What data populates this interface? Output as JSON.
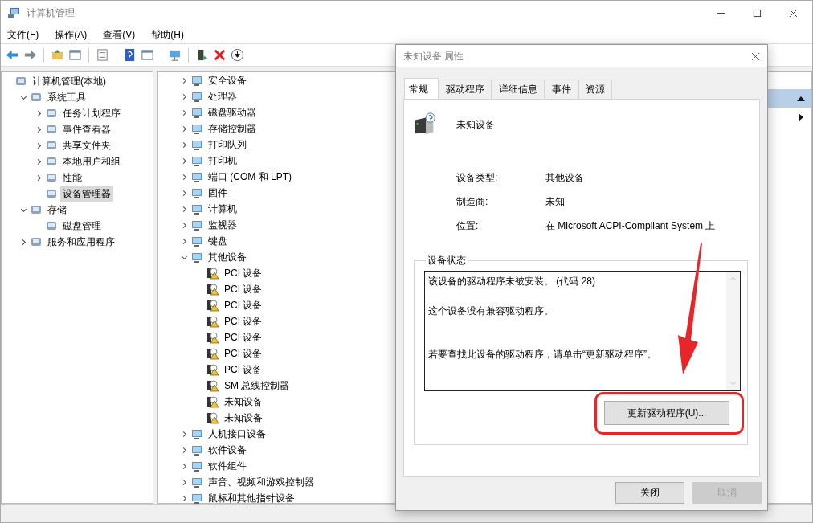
{
  "window": {
    "title": "计算机管理"
  },
  "menu": [
    "文件(F)",
    "操作(A)",
    "查看(V)",
    "帮助(H)"
  ],
  "left_tree": [
    {
      "label": "计算机管理(本地)",
      "selected": false,
      "children": [
        {
          "label": "系统工具",
          "expanded": true,
          "selected": false,
          "children": [
            {
              "label": "任务计划程序",
              "expanded": false,
              "selected": false
            },
            {
              "label": "事件查看器",
              "expanded": false,
              "selected": false
            },
            {
              "label": "共享文件夹",
              "expanded": false,
              "selected": false
            },
            {
              "label": "本地用户和组",
              "expanded": false,
              "selected": false
            },
            {
              "label": "性能",
              "expanded": false,
              "selected": false
            },
            {
              "label": "设备管理器",
              "selected": true
            }
          ]
        },
        {
          "label": "存储",
          "expanded": true,
          "selected": false,
          "children": [
            {
              "label": "磁盘管理",
              "selected": false
            }
          ]
        },
        {
          "label": "服务和应用程序",
          "expanded": false,
          "selected": false
        }
      ]
    }
  ],
  "device_tree": [
    {
      "label": "安全设备",
      "expanded": false
    },
    {
      "label": "处理器",
      "expanded": false
    },
    {
      "label": "磁盘驱动器",
      "expanded": false
    },
    {
      "label": "存储控制器",
      "expanded": false
    },
    {
      "label": "打印队列",
      "expanded": false
    },
    {
      "label": "打印机",
      "expanded": false
    },
    {
      "label": "端口 (COM 和 LPT)",
      "expanded": false
    },
    {
      "label": "固件",
      "expanded": false
    },
    {
      "label": "计算机",
      "expanded": false
    },
    {
      "label": "监视器",
      "expanded": false
    },
    {
      "label": "键盘",
      "expanded": false
    },
    {
      "label": "其他设备",
      "expanded": true,
      "children": [
        {
          "label": "PCI 设备",
          "warning": true
        },
        {
          "label": "PCI 设备",
          "warning": true
        },
        {
          "label": "PCI 设备",
          "warning": true
        },
        {
          "label": "PCI 设备",
          "warning": true
        },
        {
          "label": "PCI 设备",
          "warning": true
        },
        {
          "label": "PCI 设备",
          "warning": true
        },
        {
          "label": "PCI 设备",
          "warning": true
        },
        {
          "label": "SM 总线控制器",
          "warning": true
        },
        {
          "label": "未知设备",
          "warning": true
        },
        {
          "label": "未知设备",
          "warning": true
        }
      ]
    },
    {
      "label": "人机接口设备",
      "expanded": false
    },
    {
      "label": "软件设备",
      "expanded": false
    },
    {
      "label": "软件组件",
      "expanded": false
    },
    {
      "label": "声音、视频和游戏控制器",
      "expanded": false
    },
    {
      "label": "鼠标和其他指针设备",
      "expanded": false
    }
  ],
  "dialog": {
    "title": "未知设备 属性",
    "tabs": [
      {
        "label": "常规",
        "selected": true
      },
      {
        "label": "驱动程序",
        "selected": false
      },
      {
        "label": "详细信息",
        "selected": false
      },
      {
        "label": "事件",
        "selected": false
      },
      {
        "label": "资源",
        "selected": false
      }
    ],
    "device_name": "未知设备",
    "properties": [
      {
        "label": "设备类型:",
        "value": "其他设备"
      },
      {
        "label": "制造商:",
        "value": "未知"
      },
      {
        "label": "位置:",
        "value": "在 Microsoft ACPI-Compliant System 上"
      }
    ],
    "status_group": {
      "title": "设备状态",
      "lines": [
        "该设备的驱动程序未被安装。 (代码 28)",
        "这个设备没有兼容驱动程序。",
        "若要查找此设备的驱动程序，请单击“更新驱动程序”。"
      ]
    },
    "update_button": "更新驱动程序(U)...",
    "buttons": [
      {
        "label": "关闭",
        "disabled": false
      },
      {
        "label": "取消",
        "disabled": true
      }
    ]
  }
}
